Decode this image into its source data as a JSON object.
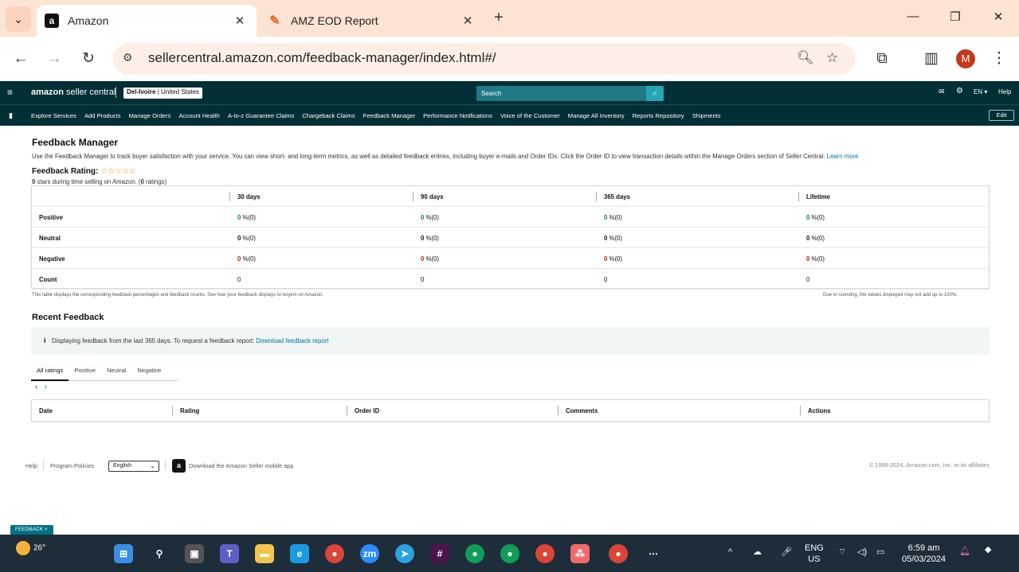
{
  "browser": {
    "tabs": [
      {
        "title": "Amazon",
        "favicon": "amazon-a-icon",
        "active": true
      },
      {
        "title": "AMZ EOD Report",
        "favicon": "pencil-icon",
        "active": false
      }
    ],
    "url": "sellercentral.amazon.com/feedback-manager/index.html#/",
    "profile_initial": "M"
  },
  "seller_central": {
    "logo_bold": "amazon",
    "logo_rest": " seller central",
    "marketplace_bold": "Del-Ivoire",
    "marketplace_rest": " | United States",
    "search_placeholder": "Search",
    "language": "EN",
    "help": "Help",
    "nav_links": [
      "Explore Services",
      "Add Products",
      "Manage Orders",
      "Account Health",
      "A-to-z Guarantee Claims",
      "Chargeback Claims",
      "Feedback Manager",
      "Performance Notifications",
      "Voice of the Customer",
      "Manage All Inventory",
      "Reports Repository",
      "Shipments"
    ],
    "edit": "Edit"
  },
  "page": {
    "title": "Feedback Manager",
    "description": "Use the Feedback Manager to track buyer satisfaction with your service. You can view short- and long-term metrics, as well as detailed feedback entries, including buyer e-mails and Order IDs. Click the Order ID to view transaction details within the Manage Orders section of Seller Central.",
    "learn_more": "Learn more",
    "rating_label": "Feedback Rating:",
    "stars": "☆☆☆☆☆",
    "rating_sub_a": "0",
    "rating_sub_b": " stars during time selling on Amazon. (",
    "rating_sub_c": "0",
    "rating_sub_d": " ratings)",
    "rating_value": 0,
    "table": {
      "headers": [
        "30 days",
        "90 days",
        "365 days",
        "Lifetime"
      ],
      "rows": [
        {
          "label": "Positive",
          "values": [
            "0",
            "0",
            "0",
            "0"
          ],
          "suffix": " %(0)",
          "color": "#067d62"
        },
        {
          "label": "Neutral",
          "values": [
            "0",
            "0",
            "0",
            "0"
          ],
          "suffix": " %(0)",
          "color": "#111111"
        },
        {
          "label": "Negative",
          "values": [
            "0",
            "0",
            "0",
            "0"
          ],
          "suffix": " %(0)",
          "color": "#b12704"
        },
        {
          "label": "Count",
          "values": [
            "0",
            "0",
            "0",
            "0"
          ],
          "suffix": "",
          "color": "#111111"
        }
      ],
      "note_left": "This table displays the corresponding feedback percentages and feedback counts. See how your feedback displays to buyers on Amazon.",
      "note_right": "Due to rounding, the values displayed may not add up to 100%."
    },
    "recent": {
      "title": "Recent Feedback",
      "info": "Displaying feedback from the last 365 days. To request a feedback report:",
      "download_link": "Download feedback report",
      "tabs": [
        "All ratings",
        "Positive",
        "Neutral",
        "Negative"
      ],
      "columns": [
        "Date",
        "Rating",
        "Order ID",
        "Comments",
        "Actions"
      ]
    }
  },
  "footer": {
    "help": "Help",
    "policies": "Program Policies",
    "language": "English",
    "app": "Download the Amazon Seller mobile app",
    "copyright": "© 1999-2024, Amazon.com, Inc. or its affiliates",
    "feedback_badge": "FEEDBACK ×"
  },
  "taskbar": {
    "temperature": "26°",
    "lang_top": "ENG",
    "lang_bottom": "US",
    "time": "6:59 am",
    "date": "05/03/2024"
  }
}
